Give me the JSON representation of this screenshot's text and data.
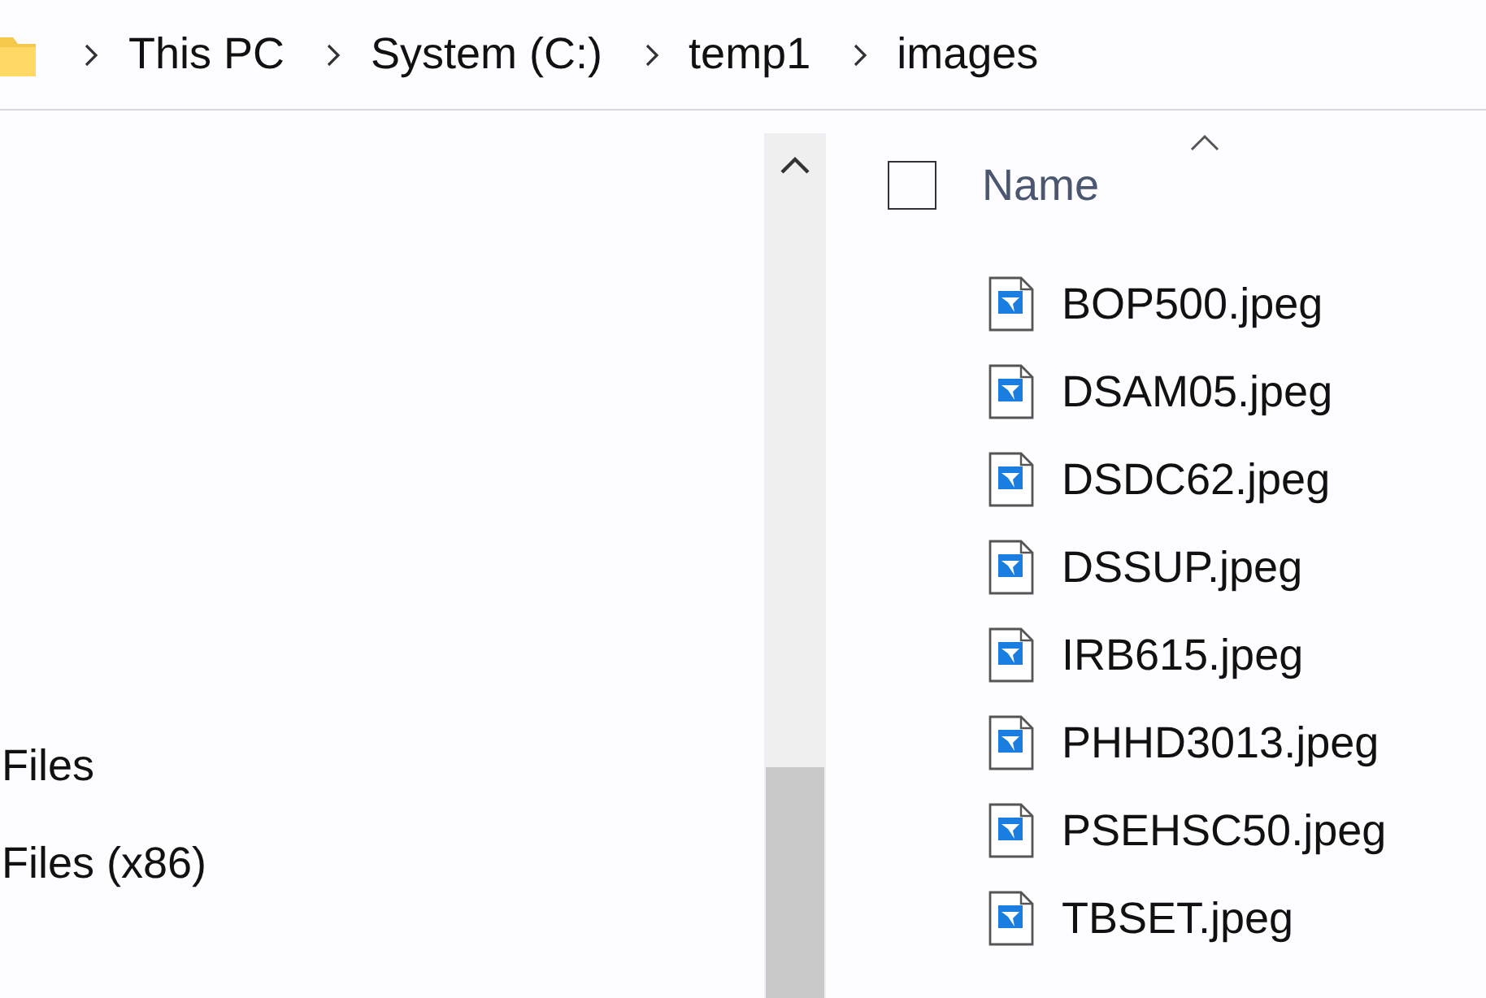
{
  "breadcrumb": [
    "This PC",
    "System (C:)",
    "temp1",
    "images"
  ],
  "nav_items": [
    "Files",
    "Files (x86)"
  ],
  "column_header": {
    "label": "Name",
    "sorted_ascending": true,
    "select_all_checked": false
  },
  "files": [
    "BOP500.jpeg",
    "DSAM05.jpeg",
    "DSDC62.jpeg",
    "DSSUP.jpeg",
    "IRB615.jpeg",
    "PHHD3013.jpeg",
    "PSEHSC50.jpeg",
    "TBSET.jpeg"
  ]
}
